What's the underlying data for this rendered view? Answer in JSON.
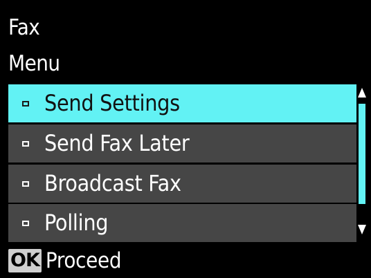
{
  "header": {
    "title": "Fax",
    "subtitle": "Menu"
  },
  "menu": {
    "items": [
      {
        "label": "Send Settings",
        "selected": true
      },
      {
        "label": "Send Fax Later",
        "selected": false
      },
      {
        "label": "Broadcast Fax",
        "selected": false
      },
      {
        "label": "Polling",
        "selected": false
      }
    ]
  },
  "scrollbar": {
    "up_icon": "arrow-up-icon",
    "down_icon": "arrow-down-icon",
    "position": 0.0,
    "visible_fraction": 0.85
  },
  "footer": {
    "key_label": "OK",
    "action_label": "Proceed"
  },
  "colors": {
    "background": "#000000",
    "item_bg": "#464646",
    "highlight": "#62f2f4",
    "text": "#ffffff"
  }
}
